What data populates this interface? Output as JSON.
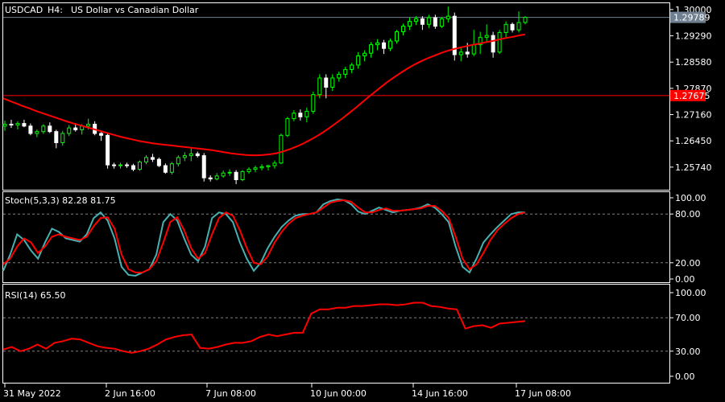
{
  "main": {
    "symbol": "USDCAD",
    "timeframe": "H4:",
    "description": "US Dollar vs Canadian Dollar",
    "price_ticks": [
      "1.30000",
      "1.29290",
      "1.28580",
      "1.27870",
      "1.27160",
      "1.26450",
      "1.25740"
    ],
    "current_price_label": "1.29789",
    "hline_label": "1.27675",
    "ma_color": "#ff0000",
    "bull_color": "#00ff00",
    "bear_color": "#ffffff",
    "hline_color": "#ff0000",
    "bid_line_color": "#708090"
  },
  "stoch": {
    "label": "Stoch(5,3,3) 82.28 81.75",
    "ticks": [
      "100.00",
      "80.00",
      "20.00",
      "0.00"
    ],
    "main_color": "#48b0b0",
    "signal_color": "#ff0000"
  },
  "rsi": {
    "label": "RSI(14) 65.50",
    "ticks": [
      "100.00",
      "70.00",
      "30.00",
      "0.00"
    ],
    "line_color": "#ff0000"
  },
  "time_labels": [
    "31 May 2022",
    "2 Jun 16:00",
    "7 Jun 08:00",
    "10 Jun 00:00",
    "14 Jun 16:00",
    "17 Jun 08:00"
  ],
  "chart_data": {
    "type": "candlestick",
    "symbol": "USDCAD",
    "timeframe": "H4",
    "price_range": [
      1.2515,
      1.3015
    ],
    "hline_price": 1.27675,
    "last_price": 1.29789,
    "ohlc": [
      [
        1.2685,
        1.27,
        1.2672,
        1.269
      ],
      [
        1.269,
        1.2702,
        1.268,
        1.2688
      ],
      [
        1.2688,
        1.2698,
        1.2676,
        1.2692
      ],
      [
        1.2692,
        1.2702,
        1.2682,
        1.2685
      ],
      [
        1.2685,
        1.2692,
        1.266,
        1.2665
      ],
      [
        1.2665,
        1.2676,
        1.2655,
        1.267
      ],
      [
        1.267,
        1.269,
        1.2664,
        1.2685
      ],
      [
        1.2685,
        1.2695,
        1.2666,
        1.267
      ],
      [
        1.267,
        1.2675,
        1.2625,
        1.264
      ],
      [
        1.264,
        1.2672,
        1.2632,
        1.2665
      ],
      [
        1.2665,
        1.2688,
        1.2658,
        1.268
      ],
      [
        1.268,
        1.2693,
        1.267,
        1.2675
      ],
      [
        1.2675,
        1.269,
        1.2662,
        1.2685
      ],
      [
        1.2685,
        1.2705,
        1.2676,
        1.269
      ],
      [
        1.269,
        1.2698,
        1.266,
        1.2665
      ],
      [
        1.2665,
        1.2672,
        1.2645,
        1.266
      ],
      [
        1.266,
        1.2664,
        1.257,
        1.258
      ],
      [
        1.258,
        1.2586,
        1.257,
        1.2578
      ],
      [
        1.2578,
        1.2586,
        1.257,
        1.258
      ],
      [
        1.258,
        1.2586,
        1.2572,
        1.2578
      ],
      [
        1.2578,
        1.2583,
        1.2563,
        1.2568
      ],
      [
        1.2568,
        1.2592,
        1.2564,
        1.2588
      ],
      [
        1.2588,
        1.2606,
        1.2582,
        1.26
      ],
      [
        1.26,
        1.261,
        1.2588,
        1.2595
      ],
      [
        1.2595,
        1.26,
        1.2574,
        1.2578
      ],
      [
        1.2578,
        1.2584,
        1.2556,
        1.256
      ],
      [
        1.256,
        1.2588,
        1.2554,
        1.2583
      ],
      [
        1.2583,
        1.2606,
        1.2576,
        1.26
      ],
      [
        1.26,
        1.2614,
        1.259,
        1.2605
      ],
      [
        1.2605,
        1.2626,
        1.259,
        1.261
      ],
      [
        1.261,
        1.2616,
        1.26,
        1.2605
      ],
      [
        1.2605,
        1.2612,
        1.2535,
        1.2545
      ],
      [
        1.2545,
        1.2552,
        1.2535,
        1.2542
      ],
      [
        1.2542,
        1.2558,
        1.2538,
        1.255
      ],
      [
        1.255,
        1.2565,
        1.2545,
        1.2558
      ],
      [
        1.2558,
        1.2568,
        1.255,
        1.256
      ],
      [
        1.256,
        1.2566,
        1.2528,
        1.254
      ],
      [
        1.254,
        1.2566,
        1.2536,
        1.2562
      ],
      [
        1.2562,
        1.2574,
        1.2556,
        1.2568
      ],
      [
        1.2568,
        1.2578,
        1.256,
        1.2572
      ],
      [
        1.2572,
        1.2582,
        1.2565,
        1.2575
      ],
      [
        1.2575,
        1.258,
        1.2565,
        1.2578
      ],
      [
        1.2578,
        1.2592,
        1.257,
        1.2585
      ],
      [
        1.2585,
        1.2665,
        1.2582,
        1.266
      ],
      [
        1.266,
        1.271,
        1.2655,
        1.2705
      ],
      [
        1.2705,
        1.2728,
        1.2698,
        1.272
      ],
      [
        1.272,
        1.273,
        1.27,
        1.271
      ],
      [
        1.271,
        1.2735,
        1.2695,
        1.2725
      ],
      [
        1.2725,
        1.2778,
        1.2718,
        1.277
      ],
      [
        1.277,
        1.2825,
        1.276,
        1.2815
      ],
      [
        1.2815,
        1.2825,
        1.276,
        1.279
      ],
      [
        1.279,
        1.2825,
        1.278,
        1.2815
      ],
      [
        1.2815,
        1.2832,
        1.2805,
        1.2825
      ],
      [
        1.2825,
        1.2845,
        1.2815,
        1.2838
      ],
      [
        1.2838,
        1.2856,
        1.2828,
        1.285
      ],
      [
        1.285,
        1.2885,
        1.284,
        1.2875
      ],
      [
        1.2875,
        1.289,
        1.286,
        1.2882
      ],
      [
        1.2882,
        1.2912,
        1.287,
        1.2905
      ],
      [
        1.2905,
        1.292,
        1.289,
        1.291
      ],
      [
        1.291,
        1.2918,
        1.288,
        1.2895
      ],
      [
        1.2895,
        1.2922,
        1.2888,
        1.2915
      ],
      [
        1.2915,
        1.2945,
        1.2908,
        1.294
      ],
      [
        1.294,
        1.2962,
        1.293,
        1.2955
      ],
      [
        1.2955,
        1.2978,
        1.2945,
        1.2968
      ],
      [
        1.2968,
        1.2982,
        1.2958,
        1.2975
      ],
      [
        1.2975,
        1.2982,
        1.2945,
        1.296
      ],
      [
        1.296,
        1.2986,
        1.295,
        1.2978
      ],
      [
        1.2978,
        1.2986,
        1.2948,
        1.2955
      ],
      [
        1.2955,
        1.298,
        1.295,
        1.2975
      ],
      [
        1.2975,
        1.3008,
        1.2965,
        1.2982
      ],
      [
        1.2982,
        1.2992,
        1.2862,
        1.2878
      ],
      [
        1.2878,
        1.2896,
        1.286,
        1.2885
      ],
      [
        1.2885,
        1.291,
        1.287,
        1.288
      ],
      [
        1.288,
        1.2945,
        1.2874,
        1.2905
      ],
      [
        1.2905,
        1.294,
        1.288,
        1.2925
      ],
      [
        1.2925,
        1.296,
        1.291,
        1.293
      ],
      [
        1.293,
        1.294,
        1.287,
        1.2885
      ],
      [
        1.2885,
        1.2945,
        1.288,
        1.2938
      ],
      [
        1.2938,
        1.2968,
        1.2925,
        1.296
      ],
      [
        1.296,
        1.2965,
        1.2938,
        1.2945
      ],
      [
        1.2945,
        1.2995,
        1.2938,
        1.2965
      ],
      [
        1.2965,
        1.2982,
        1.296,
        1.2979
      ]
    ],
    "moving_average": [
      1.276,
      1.2753,
      1.2746,
      1.2739,
      1.2733,
      1.2726,
      1.272,
      1.2714,
      1.2708,
      1.2702,
      1.2696,
      1.2691,
      1.2686,
      1.2681,
      1.2676,
      1.2671,
      1.2666,
      1.2661,
      1.2656,
      1.2652,
      1.2648,
      1.2644,
      1.2641,
      1.2638,
      1.2636,
      1.2634,
      1.2632,
      1.263,
      1.2628,
      1.2626,
      1.2624,
      1.2622,
      1.262,
      1.2617,
      1.2614,
      1.2611,
      1.2609,
      1.2607,
      1.2606,
      1.2606,
      1.2607,
      1.2609,
      1.2612,
      1.2617,
      1.2623,
      1.263,
      1.2638,
      1.2647,
      1.2657,
      1.2668,
      1.268,
      1.2693,
      1.2706,
      1.272,
      1.2734,
      1.2749,
      1.2764,
      1.2778,
      1.2792,
      1.2806,
      1.2818,
      1.283,
      1.2841,
      1.2851,
      1.286,
      1.2868,
      1.2875,
      1.2882,
      1.2888,
      1.2893,
      1.2897,
      1.2901,
      1.2905,
      1.2908,
      1.2912,
      1.2915,
      1.2919,
      1.2923,
      1.2926,
      1.293,
      1.2933
    ],
    "stoch_range": [
      0,
      100
    ],
    "stoch_levels": [
      80,
      20
    ],
    "stoch_main": [
      10,
      30,
      55,
      48,
      35,
      25,
      45,
      62,
      58,
      50,
      48,
      46,
      55,
      75,
      82,
      72,
      50,
      15,
      5,
      4,
      8,
      12,
      30,
      70,
      80,
      72,
      50,
      30,
      22,
      40,
      75,
      82,
      80,
      70,
      45,
      25,
      10,
      20,
      38,
      52,
      64,
      72,
      78,
      80,
      80,
      82,
      92,
      96,
      98,
      97,
      92,
      83,
      80,
      84,
      88,
      85,
      82,
      84,
      85,
      86,
      88,
      92,
      88,
      80,
      70,
      40,
      15,
      8,
      25,
      45,
      55,
      64,
      72,
      80,
      82,
      82
    ],
    "stoch_signal": [
      18,
      25,
      40,
      50,
      45,
      32,
      40,
      52,
      55,
      52,
      50,
      48,
      52,
      65,
      75,
      76,
      62,
      30,
      12,
      8,
      8,
      12,
      22,
      45,
      70,
      76,
      60,
      38,
      25,
      32,
      55,
      75,
      82,
      78,
      60,
      38,
      20,
      18,
      28,
      45,
      58,
      68,
      75,
      78,
      80,
      82,
      88,
      94,
      96,
      97,
      95,
      88,
      82,
      82,
      85,
      87,
      84,
      84,
      85,
      86,
      87,
      90,
      90,
      84,
      75,
      52,
      25,
      12,
      18,
      32,
      48,
      60,
      68,
      75,
      80,
      82
    ],
    "rsi_range": [
      0,
      100
    ],
    "rsi_levels": [
      70,
      30
    ],
    "rsi": [
      32,
      35,
      30,
      33,
      38,
      33,
      40,
      42,
      45,
      44,
      40,
      36,
      34,
      33,
      30,
      28,
      30,
      33,
      38,
      44,
      47,
      49,
      50,
      34,
      33,
      35,
      38,
      40,
      40,
      42,
      47,
      50,
      48,
      50,
      52,
      52,
      75,
      80,
      80,
      82,
      82,
      84,
      84,
      85,
      86,
      86,
      85,
      86,
      88,
      88,
      84,
      83,
      81,
      80,
      57,
      60,
      61,
      58,
      63,
      64,
      65,
      66
    ]
  }
}
